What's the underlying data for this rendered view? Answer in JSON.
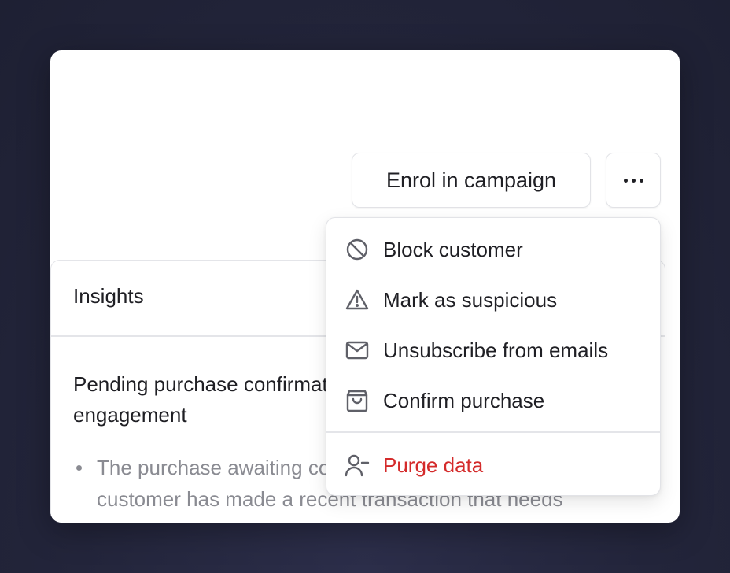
{
  "actions": {
    "enrol_label": "Enrol in campaign"
  },
  "insights": {
    "title": "Insights",
    "headline": "Pending purchase confirmation may be blocking further engagement",
    "bullet": "The purchase awaiting confirmation suggests that the customer has made a recent transaction that needs verification before proceeding."
  },
  "menu": {
    "items": [
      {
        "label": "Block customer",
        "icon": "block-icon"
      },
      {
        "label": "Mark as suspicious",
        "icon": "warning-icon"
      },
      {
        "label": "Unsubscribe from emails",
        "icon": "mail-icon"
      },
      {
        "label": "Confirm purchase",
        "icon": "shopping-bag-icon"
      }
    ],
    "danger_item": {
      "label": "Purge data",
      "icon": "user-minus-icon"
    }
  },
  "colors": {
    "danger": "#d42b2b",
    "background": "#23253b",
    "muted_text": "#8a8b92"
  }
}
